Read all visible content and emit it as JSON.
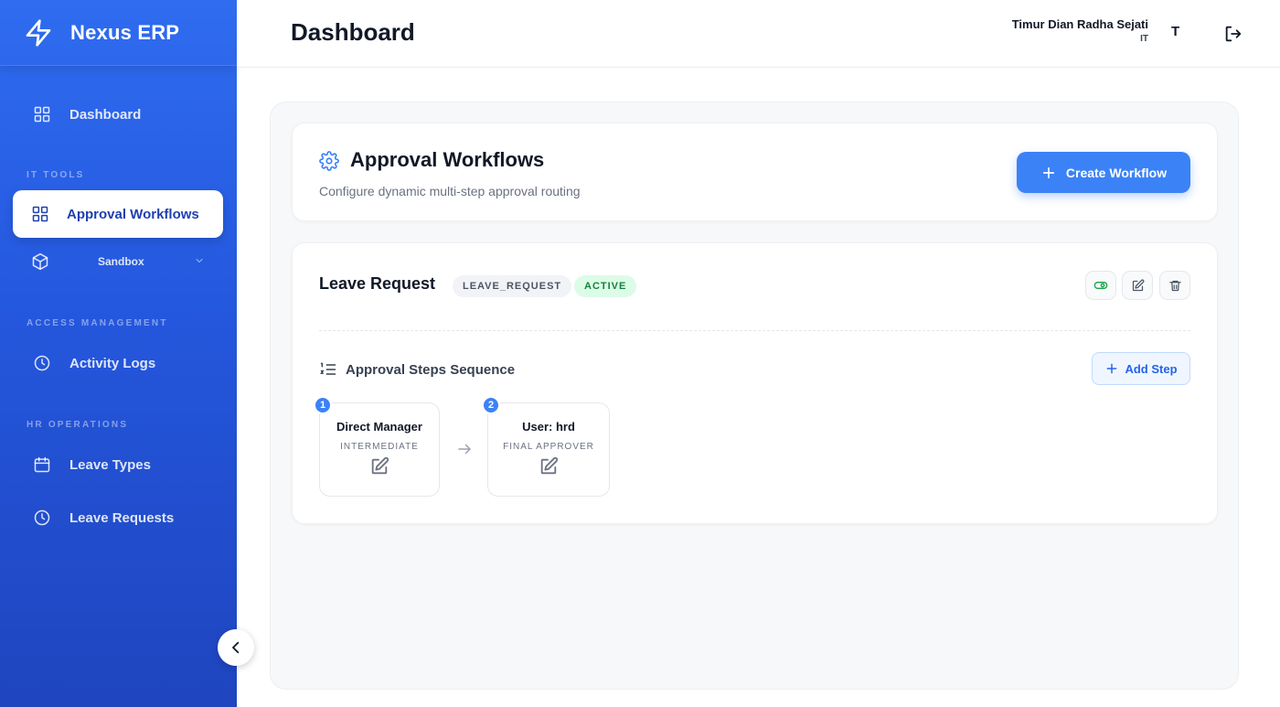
{
  "brand": {
    "name": "Nexus ERP",
    "icon": "lightning-icon"
  },
  "sidebar": {
    "dashboard": {
      "label": "Dashboard",
      "icon": "grid-icon"
    },
    "sections": [
      {
        "label": "IT TOOLS"
      },
      {
        "label": "ACCESS MANAGEMENT"
      },
      {
        "label": "HR OPERATIONS"
      }
    ],
    "items": [
      {
        "label": "Approval Workflows",
        "icon": "grid-icon",
        "active": true
      },
      {
        "label": "Sandbox",
        "icon": "cube-icon"
      },
      {
        "label": "Activity Logs",
        "icon": "clock-icon"
      },
      {
        "label": "Leave Types",
        "icon": "calendar-icon"
      },
      {
        "label": "Leave Requests",
        "icon": "clock-icon"
      }
    ],
    "colors": {
      "gradient_top": "#2f6cf0",
      "gradient_bottom": "#1f45bf",
      "active_text": "#1e3fb0"
    }
  },
  "header": {
    "title": "Dashboard",
    "user_name": "Timur Dian Radha Sejati",
    "user_role": "IT",
    "avatar_initial": "T"
  },
  "page": {
    "title": "Approval Workflows",
    "subtitle": "Configure dynamic multi-step approval routing",
    "create_button": "Create Workflow",
    "accent": "#3b82f6"
  },
  "workflow": {
    "name": "Leave Request",
    "code": "LEAVE_REQUEST",
    "status": "ACTIVE",
    "steps_heading": "Approval Steps Sequence",
    "add_step_label": "Add Step",
    "steps": [
      {
        "number": "1",
        "title": "Direct Manager",
        "type": "INTERMEDIATE"
      },
      {
        "number": "2",
        "title": "User: hrd",
        "type": "FINAL APPROVER"
      }
    ]
  }
}
